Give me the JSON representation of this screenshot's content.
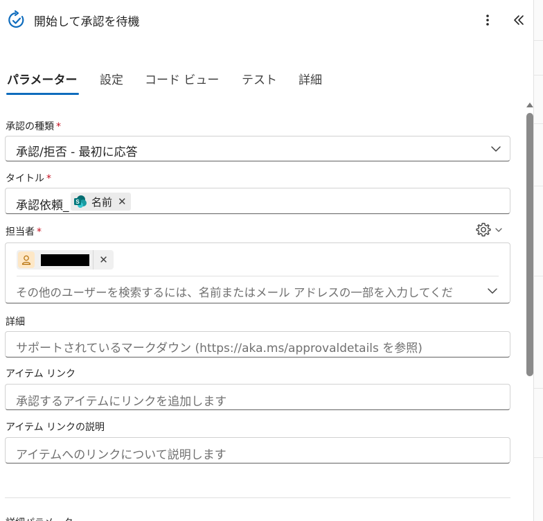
{
  "header": {
    "title": "開始して承認を待機",
    "icon": "approval-refresh-icon",
    "more_icon": "more-vertical-icon",
    "collapse_icon": "chevron-double-left-icon"
  },
  "tabs": [
    {
      "label": "パラメーター",
      "active": true
    },
    {
      "label": "設定",
      "active": false
    },
    {
      "label": "コード ビュー",
      "active": false
    },
    {
      "label": "テスト",
      "active": false
    },
    {
      "label": "詳細",
      "active": false
    }
  ],
  "required_mark": "*",
  "approval_type": {
    "label": "承認の種類",
    "value": "承認/拒否 - 最初に応答"
  },
  "title_field": {
    "label": "タイトル",
    "prefix": "承認依頼_",
    "token_label": "名前",
    "token_remove": "✕"
  },
  "assignee": {
    "label": "担当者",
    "chip_remove": "✕",
    "search_placeholder": "その他のユーザーを検索するには、名前またはメール アドレスの一部を入力してくだ"
  },
  "details": {
    "label": "詳細",
    "placeholder": "サポートされているマークダウン (https://aka.ms/approvaldetails を参照)"
  },
  "item_link": {
    "label": "アイテム リンク",
    "placeholder": "承認するアイテムにリンクを追加します"
  },
  "item_link_desc": {
    "label": "アイテム リンクの説明",
    "placeholder": "アイテムへのリンクについて説明します"
  },
  "advanced": {
    "label": "詳細パラメーター"
  },
  "colors": {
    "accent": "#0f6cbd",
    "required": "#c50f1f",
    "sharepoint": "#038387"
  }
}
